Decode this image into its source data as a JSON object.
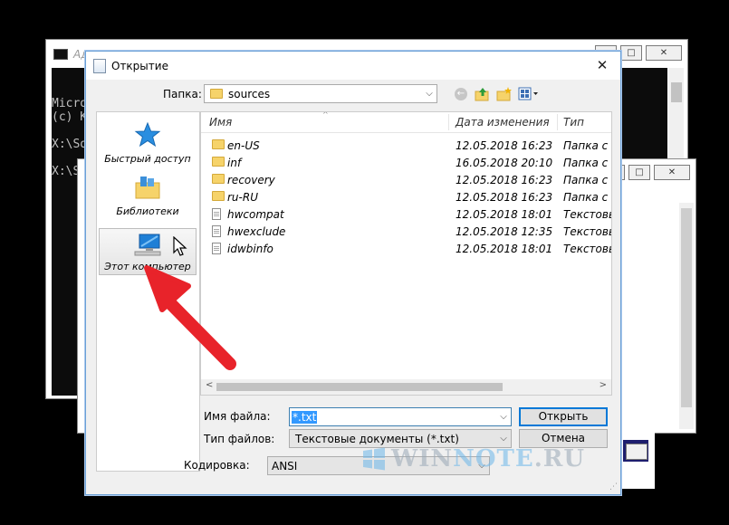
{
  "console_window": {
    "title": "Ад",
    "lines": [
      "Micro",
      "(c) К",
      "",
      "X:\\So",
      "",
      "X:\\So"
    ]
  },
  "dialog": {
    "title": "Открытие",
    "close_glyph": "✕",
    "folder_label": "Папка:",
    "folder_value": "sources"
  },
  "places": [
    {
      "label": "Быстрый доступ",
      "icon": "star-icon"
    },
    {
      "label": "Библиотеки",
      "icon": "libraries-icon"
    },
    {
      "label": "Этот компьютер",
      "icon": "computer-icon"
    }
  ],
  "columns": {
    "name": "Имя",
    "date": "Дата изменения",
    "type": "Тип"
  },
  "files": [
    {
      "name": "en-US",
      "date": "12.05.2018 16:23",
      "type": "Папка с ф",
      "kind": "folder"
    },
    {
      "name": "inf",
      "date": "16.05.2018 20:10",
      "type": "Папка с ф",
      "kind": "folder"
    },
    {
      "name": "recovery",
      "date": "12.05.2018 16:23",
      "type": "Папка с ф",
      "kind": "folder"
    },
    {
      "name": "ru-RU",
      "date": "12.05.2018 16:23",
      "type": "Папка с ф",
      "kind": "folder"
    },
    {
      "name": "hwcompat",
      "date": "12.05.2018 18:01",
      "type": "Текстовы",
      "kind": "file"
    },
    {
      "name": "hwexclude",
      "date": "12.05.2018 12:35",
      "type": "Текстовы",
      "kind": "file"
    },
    {
      "name": "idwbinfo",
      "date": "12.05.2018 18:01",
      "type": "Текстовы",
      "kind": "file"
    }
  ],
  "form": {
    "filename_label": "Имя файла:",
    "filename_value": "*.txt",
    "filetype_label": "Тип файлов:",
    "filetype_value": "Текстовые документы (*.txt)",
    "encoding_label": "Кодировка:",
    "encoding_value": "ANSI",
    "open_label": "Открыть",
    "cancel_label": "Отмена"
  },
  "watermark": {
    "prefix": "WIN",
    "highlight": "NOTE",
    "suffix": ".RU"
  },
  "colors": {
    "accent": "#0078d7",
    "arrow": "#e8232a",
    "selection": "#3399ff",
    "folder": "#f6d36a"
  }
}
